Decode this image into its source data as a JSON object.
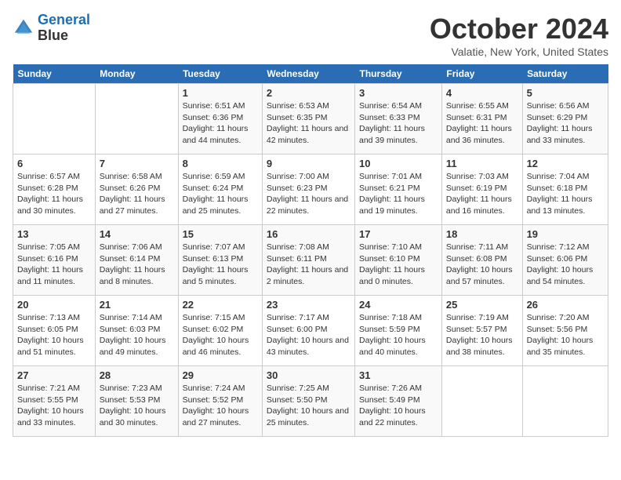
{
  "header": {
    "logo_line1": "General",
    "logo_line2": "Blue",
    "month": "October 2024",
    "location": "Valatie, New York, United States"
  },
  "days_of_week": [
    "Sunday",
    "Monday",
    "Tuesday",
    "Wednesday",
    "Thursday",
    "Friday",
    "Saturday"
  ],
  "weeks": [
    [
      {
        "day": "",
        "info": ""
      },
      {
        "day": "",
        "info": ""
      },
      {
        "day": "1",
        "info": "Sunrise: 6:51 AM\nSunset: 6:36 PM\nDaylight: 11 hours and 44 minutes."
      },
      {
        "day": "2",
        "info": "Sunrise: 6:53 AM\nSunset: 6:35 PM\nDaylight: 11 hours and 42 minutes."
      },
      {
        "day": "3",
        "info": "Sunrise: 6:54 AM\nSunset: 6:33 PM\nDaylight: 11 hours and 39 minutes."
      },
      {
        "day": "4",
        "info": "Sunrise: 6:55 AM\nSunset: 6:31 PM\nDaylight: 11 hours and 36 minutes."
      },
      {
        "day": "5",
        "info": "Sunrise: 6:56 AM\nSunset: 6:29 PM\nDaylight: 11 hours and 33 minutes."
      }
    ],
    [
      {
        "day": "6",
        "info": "Sunrise: 6:57 AM\nSunset: 6:28 PM\nDaylight: 11 hours and 30 minutes."
      },
      {
        "day": "7",
        "info": "Sunrise: 6:58 AM\nSunset: 6:26 PM\nDaylight: 11 hours and 27 minutes."
      },
      {
        "day": "8",
        "info": "Sunrise: 6:59 AM\nSunset: 6:24 PM\nDaylight: 11 hours and 25 minutes."
      },
      {
        "day": "9",
        "info": "Sunrise: 7:00 AM\nSunset: 6:23 PM\nDaylight: 11 hours and 22 minutes."
      },
      {
        "day": "10",
        "info": "Sunrise: 7:01 AM\nSunset: 6:21 PM\nDaylight: 11 hours and 19 minutes."
      },
      {
        "day": "11",
        "info": "Sunrise: 7:03 AM\nSunset: 6:19 PM\nDaylight: 11 hours and 16 minutes."
      },
      {
        "day": "12",
        "info": "Sunrise: 7:04 AM\nSunset: 6:18 PM\nDaylight: 11 hours and 13 minutes."
      }
    ],
    [
      {
        "day": "13",
        "info": "Sunrise: 7:05 AM\nSunset: 6:16 PM\nDaylight: 11 hours and 11 minutes."
      },
      {
        "day": "14",
        "info": "Sunrise: 7:06 AM\nSunset: 6:14 PM\nDaylight: 11 hours and 8 minutes."
      },
      {
        "day": "15",
        "info": "Sunrise: 7:07 AM\nSunset: 6:13 PM\nDaylight: 11 hours and 5 minutes."
      },
      {
        "day": "16",
        "info": "Sunrise: 7:08 AM\nSunset: 6:11 PM\nDaylight: 11 hours and 2 minutes."
      },
      {
        "day": "17",
        "info": "Sunrise: 7:10 AM\nSunset: 6:10 PM\nDaylight: 11 hours and 0 minutes."
      },
      {
        "day": "18",
        "info": "Sunrise: 7:11 AM\nSunset: 6:08 PM\nDaylight: 10 hours and 57 minutes."
      },
      {
        "day": "19",
        "info": "Sunrise: 7:12 AM\nSunset: 6:06 PM\nDaylight: 10 hours and 54 minutes."
      }
    ],
    [
      {
        "day": "20",
        "info": "Sunrise: 7:13 AM\nSunset: 6:05 PM\nDaylight: 10 hours and 51 minutes."
      },
      {
        "day": "21",
        "info": "Sunrise: 7:14 AM\nSunset: 6:03 PM\nDaylight: 10 hours and 49 minutes."
      },
      {
        "day": "22",
        "info": "Sunrise: 7:15 AM\nSunset: 6:02 PM\nDaylight: 10 hours and 46 minutes."
      },
      {
        "day": "23",
        "info": "Sunrise: 7:17 AM\nSunset: 6:00 PM\nDaylight: 10 hours and 43 minutes."
      },
      {
        "day": "24",
        "info": "Sunrise: 7:18 AM\nSunset: 5:59 PM\nDaylight: 10 hours and 40 minutes."
      },
      {
        "day": "25",
        "info": "Sunrise: 7:19 AM\nSunset: 5:57 PM\nDaylight: 10 hours and 38 minutes."
      },
      {
        "day": "26",
        "info": "Sunrise: 7:20 AM\nSunset: 5:56 PM\nDaylight: 10 hours and 35 minutes."
      }
    ],
    [
      {
        "day": "27",
        "info": "Sunrise: 7:21 AM\nSunset: 5:55 PM\nDaylight: 10 hours and 33 minutes."
      },
      {
        "day": "28",
        "info": "Sunrise: 7:23 AM\nSunset: 5:53 PM\nDaylight: 10 hours and 30 minutes."
      },
      {
        "day": "29",
        "info": "Sunrise: 7:24 AM\nSunset: 5:52 PM\nDaylight: 10 hours and 27 minutes."
      },
      {
        "day": "30",
        "info": "Sunrise: 7:25 AM\nSunset: 5:50 PM\nDaylight: 10 hours and 25 minutes."
      },
      {
        "day": "31",
        "info": "Sunrise: 7:26 AM\nSunset: 5:49 PM\nDaylight: 10 hours and 22 minutes."
      },
      {
        "day": "",
        "info": ""
      },
      {
        "day": "",
        "info": ""
      }
    ]
  ]
}
